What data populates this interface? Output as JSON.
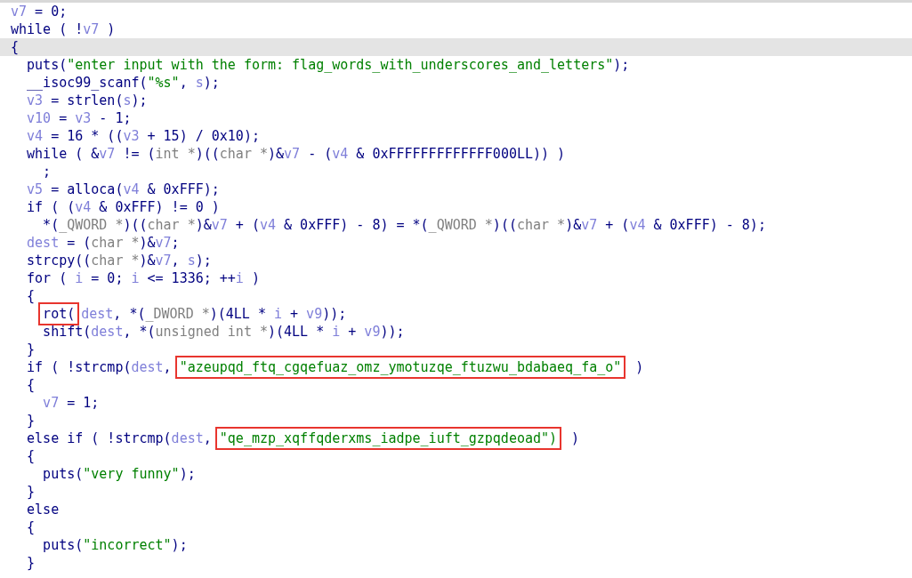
{
  "code_lines": [
    {
      "kind": "top",
      "highlighted": false,
      "tokens": [
        {
          "t": "v7",
          "kind": "var"
        },
        {
          "t": " = 0;",
          "kind": "plain"
        }
      ]
    },
    {
      "kind": "top",
      "highlighted": false,
      "tokens": [
        {
          "t": "while ( !",
          "kind": "plain"
        },
        {
          "t": "v7",
          "kind": "var"
        },
        {
          "t": " )",
          "kind": "plain"
        }
      ]
    },
    {
      "kind": "top",
      "highlighted": true,
      "tokens": [
        {
          "t": "{",
          "kind": "plain"
        }
      ]
    },
    {
      "kind": "nested",
      "highlighted": false,
      "tokens": [
        {
          "t": "puts(",
          "kind": "plain"
        },
        {
          "t": "\"enter input with the form: flag_words_with_underscores_and_letters\"",
          "kind": "string"
        },
        {
          "t": ");",
          "kind": "plain"
        }
      ]
    },
    {
      "kind": "nested",
      "highlighted": false,
      "tokens": [
        {
          "t": "__isoc99_scanf(",
          "kind": "plain"
        },
        {
          "t": "\"%s\"",
          "kind": "string"
        },
        {
          "t": ", ",
          "kind": "plain"
        },
        {
          "t": "s",
          "kind": "var"
        },
        {
          "t": ");",
          "kind": "plain"
        }
      ]
    },
    {
      "kind": "nested",
      "highlighted": false,
      "tokens": [
        {
          "t": "v3",
          "kind": "var"
        },
        {
          "t": " = strlen(",
          "kind": "plain"
        },
        {
          "t": "s",
          "kind": "var"
        },
        {
          "t": ");",
          "kind": "plain"
        }
      ]
    },
    {
      "kind": "nested",
      "highlighted": false,
      "tokens": [
        {
          "t": "v10",
          "kind": "var"
        },
        {
          "t": " = ",
          "kind": "plain"
        },
        {
          "t": "v3",
          "kind": "var"
        },
        {
          "t": " - 1;",
          "kind": "plain"
        }
      ]
    },
    {
      "kind": "nested",
      "highlighted": false,
      "tokens": [
        {
          "t": "v4",
          "kind": "var"
        },
        {
          "t": " = 16 * ((",
          "kind": "plain"
        },
        {
          "t": "v3",
          "kind": "var"
        },
        {
          "t": " + 15) / 0x10);",
          "kind": "plain"
        }
      ]
    },
    {
      "kind": "nested",
      "highlighted": false,
      "tokens": [
        {
          "t": "while ( &",
          "kind": "plain"
        },
        {
          "t": "v7",
          "kind": "var"
        },
        {
          "t": " != (",
          "kind": "plain"
        },
        {
          "t": "int *",
          "kind": "type"
        },
        {
          "t": ")((",
          "kind": "plain"
        },
        {
          "t": "char *",
          "kind": "type"
        },
        {
          "t": ")&",
          "kind": "plain"
        },
        {
          "t": "v7",
          "kind": "var"
        },
        {
          "t": " - (",
          "kind": "plain"
        },
        {
          "t": "v4",
          "kind": "var"
        },
        {
          "t": " & 0xFFFFFFFFFFFFF000LL)) )",
          "kind": "plain"
        }
      ]
    },
    {
      "kind": "inner",
      "highlighted": false,
      "tokens": [
        {
          "t": ";",
          "kind": "plain"
        }
      ]
    },
    {
      "kind": "nested",
      "highlighted": false,
      "tokens": [
        {
          "t": "v5",
          "kind": "var"
        },
        {
          "t": " = alloca(",
          "kind": "plain"
        },
        {
          "t": "v4",
          "kind": "var"
        },
        {
          "t": " & 0xFFF);",
          "kind": "plain"
        }
      ]
    },
    {
      "kind": "nested",
      "highlighted": false,
      "tokens": [
        {
          "t": "if ( (",
          "kind": "plain"
        },
        {
          "t": "v4",
          "kind": "var"
        },
        {
          "t": " & 0xFFF) != 0 )",
          "kind": "plain"
        }
      ]
    },
    {
      "kind": "inner",
      "highlighted": false,
      "tokens": [
        {
          "t": "*(",
          "kind": "plain"
        },
        {
          "t": "_QWORD *",
          "kind": "type"
        },
        {
          "t": ")((",
          "kind": "plain"
        },
        {
          "t": "char *",
          "kind": "type"
        },
        {
          "t": ")&",
          "kind": "plain"
        },
        {
          "t": "v7",
          "kind": "var"
        },
        {
          "t": " + (",
          "kind": "plain"
        },
        {
          "t": "v4",
          "kind": "var"
        },
        {
          "t": " & 0xFFF) - 8) = *(",
          "kind": "plain"
        },
        {
          "t": "_QWORD *",
          "kind": "type"
        },
        {
          "t": ")((",
          "kind": "plain"
        },
        {
          "t": "char *",
          "kind": "type"
        },
        {
          "t": ")&",
          "kind": "plain"
        },
        {
          "t": "v7",
          "kind": "var"
        },
        {
          "t": " + (",
          "kind": "plain"
        },
        {
          "t": "v4",
          "kind": "var"
        },
        {
          "t": " & 0xFFF) - 8);",
          "kind": "plain"
        }
      ]
    },
    {
      "kind": "nested",
      "highlighted": false,
      "tokens": [
        {
          "t": "dest",
          "kind": "var"
        },
        {
          "t": " = (",
          "kind": "plain"
        },
        {
          "t": "char *",
          "kind": "type"
        },
        {
          "t": ")&",
          "kind": "plain"
        },
        {
          "t": "v7",
          "kind": "var"
        },
        {
          "t": ";",
          "kind": "plain"
        }
      ]
    },
    {
      "kind": "nested",
      "highlighted": false,
      "tokens": [
        {
          "t": "strcpy((",
          "kind": "plain"
        },
        {
          "t": "char *",
          "kind": "type"
        },
        {
          "t": ")&",
          "kind": "plain"
        },
        {
          "t": "v7",
          "kind": "var"
        },
        {
          "t": ", ",
          "kind": "plain"
        },
        {
          "t": "s",
          "kind": "var"
        },
        {
          "t": ");",
          "kind": "plain"
        }
      ]
    },
    {
      "kind": "nested",
      "highlighted": false,
      "tokens": [
        {
          "t": "for ( ",
          "kind": "plain"
        },
        {
          "t": "i",
          "kind": "var"
        },
        {
          "t": " = 0; ",
          "kind": "plain"
        },
        {
          "t": "i",
          "kind": "var"
        },
        {
          "t": " <= 1336; ++",
          "kind": "plain"
        },
        {
          "t": "i",
          "kind": "var"
        },
        {
          "t": " )",
          "kind": "plain"
        }
      ]
    },
    {
      "kind": "nested",
      "highlighted": false,
      "tokens": [
        {
          "t": "{",
          "kind": "plain"
        }
      ]
    },
    {
      "kind": "inner",
      "highlighted": false,
      "tokens": [
        {
          "t": "rot(",
          "kind": "plain",
          "boxed": true
        },
        {
          "t": "dest",
          "kind": "var"
        },
        {
          "t": ", *(",
          "kind": "plain"
        },
        {
          "t": "_DWORD *",
          "kind": "type"
        },
        {
          "t": ")(4LL * ",
          "kind": "plain"
        },
        {
          "t": "i",
          "kind": "var"
        },
        {
          "t": " + ",
          "kind": "plain"
        },
        {
          "t": "v9",
          "kind": "var"
        },
        {
          "t": "));",
          "kind": "plain"
        }
      ]
    },
    {
      "kind": "inner",
      "highlighted": false,
      "tokens": [
        {
          "t": "shift(",
          "kind": "plain"
        },
        {
          "t": "dest",
          "kind": "var"
        },
        {
          "t": ", *(",
          "kind": "plain"
        },
        {
          "t": "unsigned int *",
          "kind": "type"
        },
        {
          "t": ")(4LL * ",
          "kind": "plain"
        },
        {
          "t": "i",
          "kind": "var"
        },
        {
          "t": " + ",
          "kind": "plain"
        },
        {
          "t": "v9",
          "kind": "var"
        },
        {
          "t": "));",
          "kind": "plain"
        }
      ]
    },
    {
      "kind": "nested",
      "highlighted": false,
      "tokens": [
        {
          "t": "}",
          "kind": "plain"
        }
      ]
    },
    {
      "kind": "nested",
      "highlighted": false,
      "tokens": [
        {
          "t": "if ( !strcmp(",
          "kind": "plain"
        },
        {
          "t": "dest",
          "kind": "var"
        },
        {
          "t": ", ",
          "kind": "plain"
        },
        {
          "t": "\"azeupqd_ftq_cgqefuaz_omz_ymotuzqe_ftuzwu_bdabaeq_fa_o\"",
          "kind": "string",
          "boxed": true
        },
        {
          "t": " )",
          "kind": "plain"
        }
      ]
    },
    {
      "kind": "nested",
      "highlighted": false,
      "tokens": [
        {
          "t": "{",
          "kind": "plain"
        }
      ]
    },
    {
      "kind": "inner",
      "highlighted": false,
      "tokens": [
        {
          "t": "v7",
          "kind": "var"
        },
        {
          "t": " = 1;",
          "kind": "plain"
        }
      ]
    },
    {
      "kind": "nested",
      "highlighted": false,
      "tokens": [
        {
          "t": "}",
          "kind": "plain"
        }
      ]
    },
    {
      "kind": "nested",
      "highlighted": false,
      "tokens": [
        {
          "t": "else if ( !strcmp(",
          "kind": "plain"
        },
        {
          "t": "dest",
          "kind": "var"
        },
        {
          "t": ", ",
          "kind": "plain"
        },
        {
          "t": "\"qe_mzp_xqffqderxms_iadpe_iuft_gzpqdeoad\")",
          "kind": "string",
          "boxed": true
        },
        {
          "t": " )",
          "kind": "plain"
        }
      ]
    },
    {
      "kind": "nested",
      "highlighted": false,
      "tokens": [
        {
          "t": "{",
          "kind": "plain"
        }
      ]
    },
    {
      "kind": "inner",
      "highlighted": false,
      "tokens": [
        {
          "t": "puts(",
          "kind": "plain"
        },
        {
          "t": "\"very funny\"",
          "kind": "string"
        },
        {
          "t": ");",
          "kind": "plain"
        }
      ]
    },
    {
      "kind": "nested",
      "highlighted": false,
      "tokens": [
        {
          "t": "}",
          "kind": "plain"
        }
      ]
    },
    {
      "kind": "nested",
      "highlighted": false,
      "tokens": [
        {
          "t": "else",
          "kind": "plain"
        }
      ]
    },
    {
      "kind": "nested",
      "highlighted": false,
      "tokens": [
        {
          "t": "{",
          "kind": "plain"
        }
      ]
    },
    {
      "kind": "inner",
      "highlighted": false,
      "tokens": [
        {
          "t": "puts(",
          "kind": "plain"
        },
        {
          "t": "\"incorrect\"",
          "kind": "string"
        },
        {
          "t": ");",
          "kind": "plain"
        }
      ]
    },
    {
      "kind": "nested",
      "highlighted": false,
      "tokens": [
        {
          "t": "}",
          "kind": "plain"
        }
      ]
    }
  ]
}
